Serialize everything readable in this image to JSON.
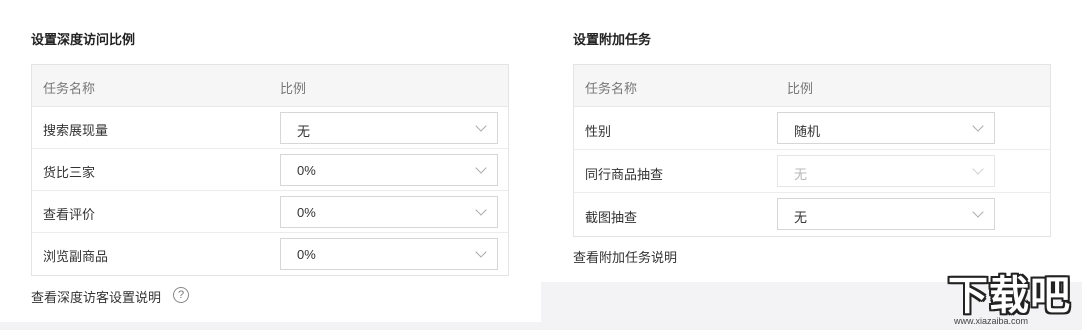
{
  "left": {
    "title": "设置深度访问比例",
    "header": {
      "name": "任务名称",
      "ratio": "比例"
    },
    "rows": [
      {
        "label": "搜索展现量",
        "value": "无"
      },
      {
        "label": "货比三家",
        "value": "0%"
      },
      {
        "label": "查看评价",
        "value": "0%"
      },
      {
        "label": "浏览副商品",
        "value": "0%"
      }
    ],
    "help_link": "查看深度访客设置说明",
    "help_icon": "?"
  },
  "right": {
    "title": "设置附加任务",
    "header": {
      "name": "任务名称",
      "ratio": "比例"
    },
    "rows": [
      {
        "label": "性别",
        "value": "随机"
      },
      {
        "label": "同行商品抽查",
        "value": "无"
      },
      {
        "label": "截图抽查",
        "value": "无"
      }
    ],
    "help_link": "查看附加任务说明"
  },
  "watermark": {
    "text": "下载吧",
    "url": "www.xiazaiba.com"
  }
}
